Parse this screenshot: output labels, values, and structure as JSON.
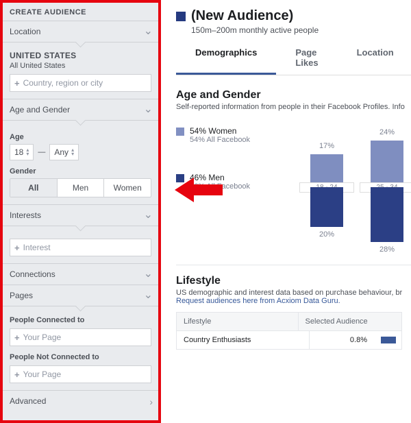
{
  "sidebar": {
    "header": "CREATE AUDIENCE",
    "sections": {
      "location": {
        "title": "Location",
        "countryCaps": "UNITED STATES",
        "countrySub": "All United States",
        "placeholder": "Country, region or city"
      },
      "ageGender": {
        "title": "Age and Gender",
        "ageLabel": "Age",
        "ageFrom": "18",
        "ageTo": "Any",
        "genderLabel": "Gender",
        "genderOptions": [
          "All",
          "Men",
          "Women"
        ],
        "genderSelected": "All"
      },
      "interests": {
        "title": "Interests",
        "placeholder": "Interest"
      },
      "connections": {
        "title": "Connections"
      },
      "pages": {
        "title": "Pages",
        "connectedLabel": "People Connected to",
        "notConnectedLabel": "People Not Connected to",
        "placeholder": "Your Page"
      },
      "advanced": {
        "title": "Advanced"
      }
    }
  },
  "main": {
    "title": "(New Audience)",
    "subtitle": "150m–200m monthly active people",
    "tabs": [
      "Demographics",
      "Page Likes",
      "Location"
    ],
    "activeTab": "Demographics",
    "ageGender": {
      "heading": "Age and Gender",
      "desc": "Self-reported information from people in their Facebook Profiles. Info",
      "women": {
        "line1": "54% Women",
        "line2": "54% All Facebook"
      },
      "men": {
        "line1": "46% Men",
        "line2": "46% All Facebook"
      }
    },
    "lifestyle": {
      "heading": "Lifestyle",
      "descPrefix": "US demographic and interest data based on purchase behaviour, br",
      "link": "Request audiences here from Acxiom Data Guru.",
      "tableHeaders": [
        "Lifestyle",
        "Selected Audience"
      ],
      "row1": {
        "name": "Country Enthusiasts",
        "pct": "0.8%"
      }
    }
  },
  "chart_data": {
    "type": "bar",
    "categories": [
      "18 - 24",
      "25 - 34"
    ],
    "series": [
      {
        "name": "Women",
        "values": [
          17,
          24
        ],
        "color": "#7f8ec0"
      },
      {
        "name": "Men",
        "values": [
          20,
          28
        ],
        "color": "#2b3f85"
      }
    ],
    "unit": "percent",
    "orientation": "vertical",
    "note": "Women bars drawn upward, Men bars drawn downward from shared baseline; additional age buckets cropped out of view"
  }
}
